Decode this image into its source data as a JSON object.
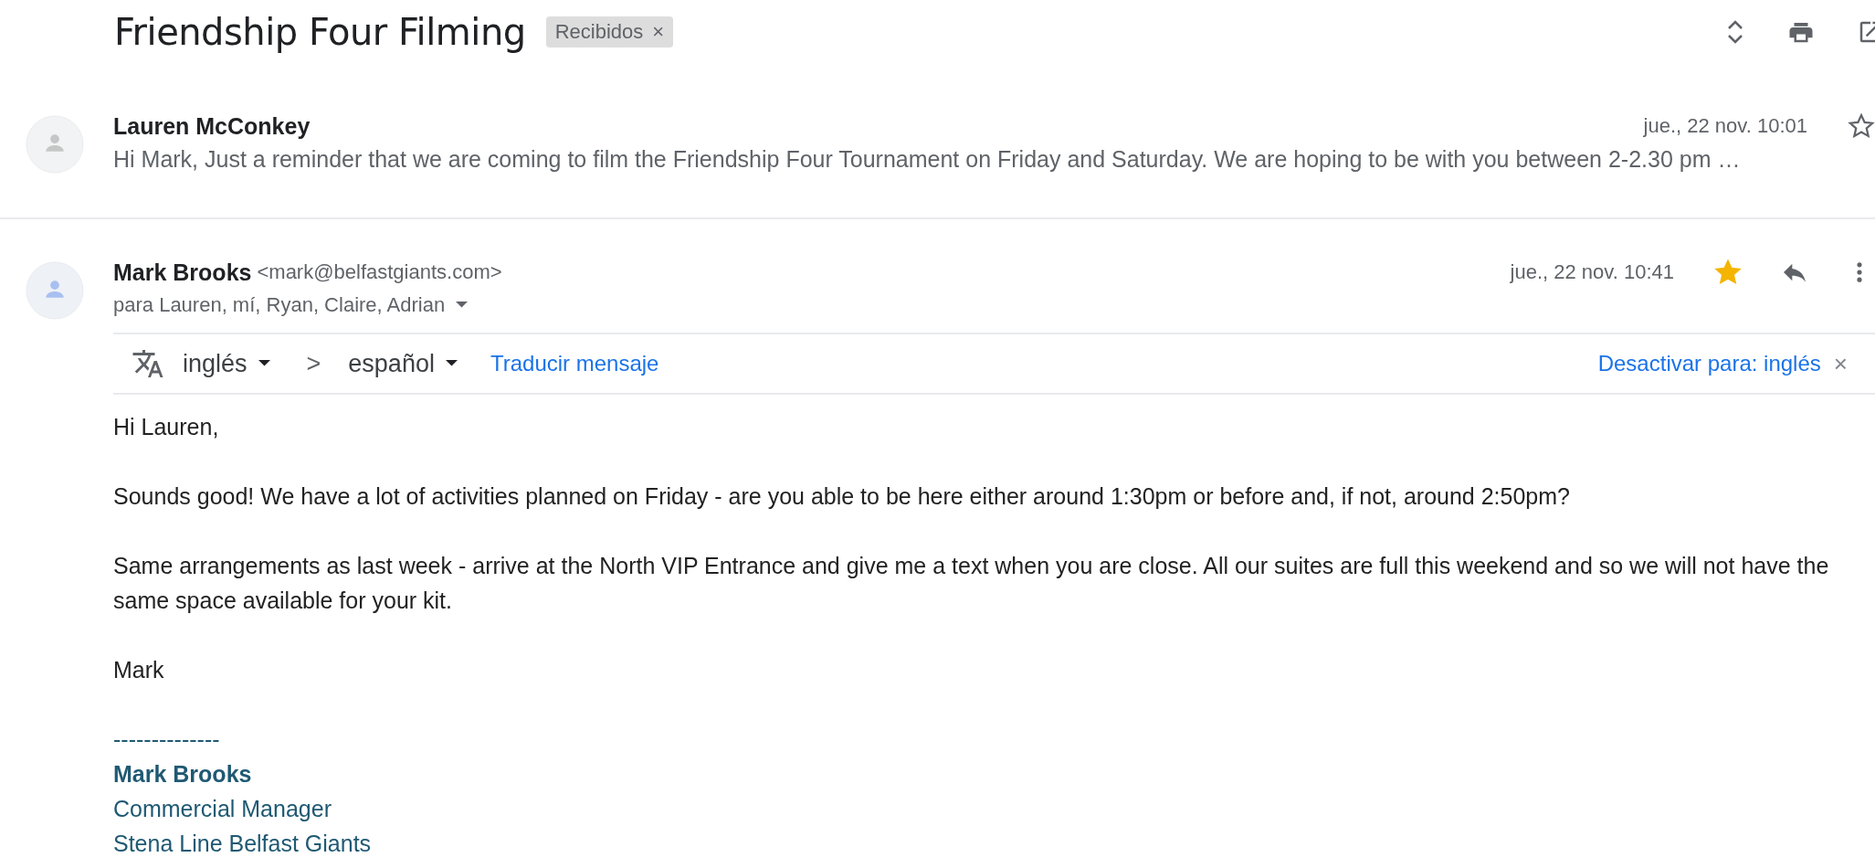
{
  "subject": "Friendship Four Filming",
  "label": {
    "text": "Recibidos",
    "remove": "×"
  },
  "messages": [
    {
      "kind": "collapsed",
      "sender": "Lauren McConkey",
      "date": "jue., 22 nov. 10:01",
      "starred": false,
      "snippet": "Hi Mark, Just a reminder that we are coming to film the Friendship Four Tournament on Friday and Saturday. We are hoping to be with you between 2-2.30 pm …"
    },
    {
      "kind": "expanded",
      "sender": "Mark Brooks",
      "email": "<mark@belfastgiants.com>",
      "recipients": "para Lauren, mí, Ryan, Claire, Adrian",
      "date": "jue., 22 nov. 10:41",
      "starred": true,
      "translate": {
        "from": "inglés",
        "arrow": ">",
        "to": "español",
        "action": "Traducir mensaje",
        "disable": "Desactivar para: inglés",
        "close": "×"
      },
      "body": [
        "Hi Lauren,",
        "Sounds good! We have a lot of activities planned on Friday - are you able to be here either around 1:30pm or before and, if not, around 2:50pm?",
        "Same arrangements as last week - arrive at the North VIP Entrance and give me a text when you are close. All our suites are full this weekend and so we will not have the same space available for your kit.",
        "Mark"
      ],
      "signature": [
        {
          "kind": "rule",
          "text": "--------------"
        },
        {
          "kind": "name",
          "text": "Mark Brooks"
        },
        {
          "kind": "line",
          "text": "Commercial Manager"
        },
        {
          "kind": "line",
          "text": "Stena Line Belfast Giants"
        }
      ]
    }
  ]
}
